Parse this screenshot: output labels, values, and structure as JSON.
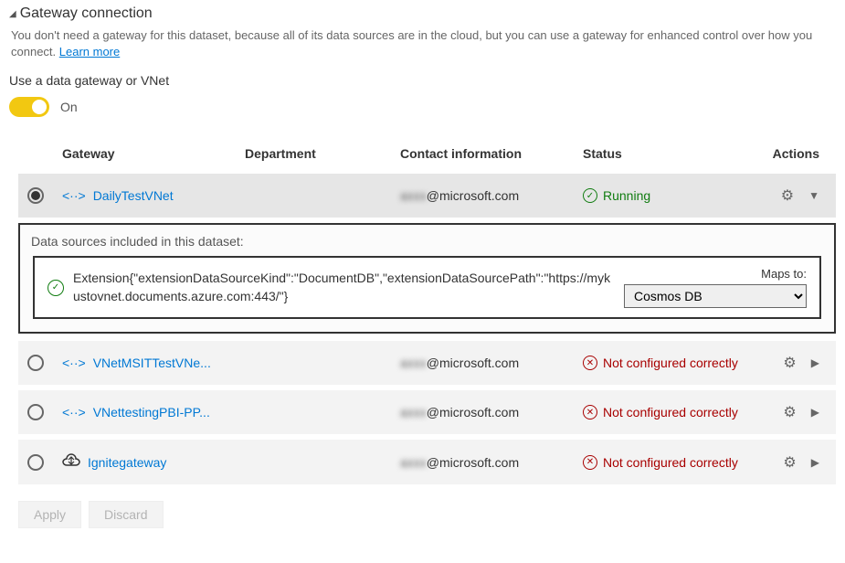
{
  "header": {
    "title": "Gateway connection",
    "description_prefix": "You don't need a gateway for this dataset, because all of its data sources are in the cloud, but you can use a gateway for enhanced control over how you connect. ",
    "learn_more": "Learn more"
  },
  "toggle": {
    "label": "Use a data gateway or VNet",
    "state_text": "On"
  },
  "columns": {
    "gateway": "Gateway",
    "department": "Department",
    "contact": "Contact information",
    "status": "Status",
    "actions": "Actions"
  },
  "status_labels": {
    "running": "Running",
    "not_configured": "Not configured correctly"
  },
  "rows": [
    {
      "name": "DailyTestVNet",
      "type": "vnet",
      "contact_masked": "axxx",
      "contact_domain": "@microsoft.com",
      "status": "running",
      "selected": true,
      "expanded": true
    },
    {
      "name": "VNetMSITTestVNe...",
      "type": "vnet",
      "contact_masked": "axxx",
      "contact_domain": "@microsoft.com",
      "status": "not_configured",
      "selected": false,
      "expanded": false
    },
    {
      "name": "VNettestingPBI-PP...",
      "type": "vnet",
      "contact_masked": "axxx",
      "contact_domain": "@microsoft.com",
      "status": "not_configured",
      "selected": false,
      "expanded": false
    },
    {
      "name": "Ignitegateway",
      "type": "onprem",
      "contact_masked": "axxx",
      "contact_domain": "@microsoft.com",
      "status": "not_configured",
      "selected": false,
      "expanded": false
    }
  ],
  "expanded": {
    "title": "Data sources included in this dataset:",
    "ds_text": "Extension{\"extensionDataSourceKind\":\"DocumentDB\",\"extensionDataSourcePath\":\"https://mykustovnet.documents.azure.com:443/\"}",
    "maps_to_label": "Maps to:",
    "maps_to_value": "Cosmos DB"
  },
  "buttons": {
    "apply": "Apply",
    "discard": "Discard"
  }
}
